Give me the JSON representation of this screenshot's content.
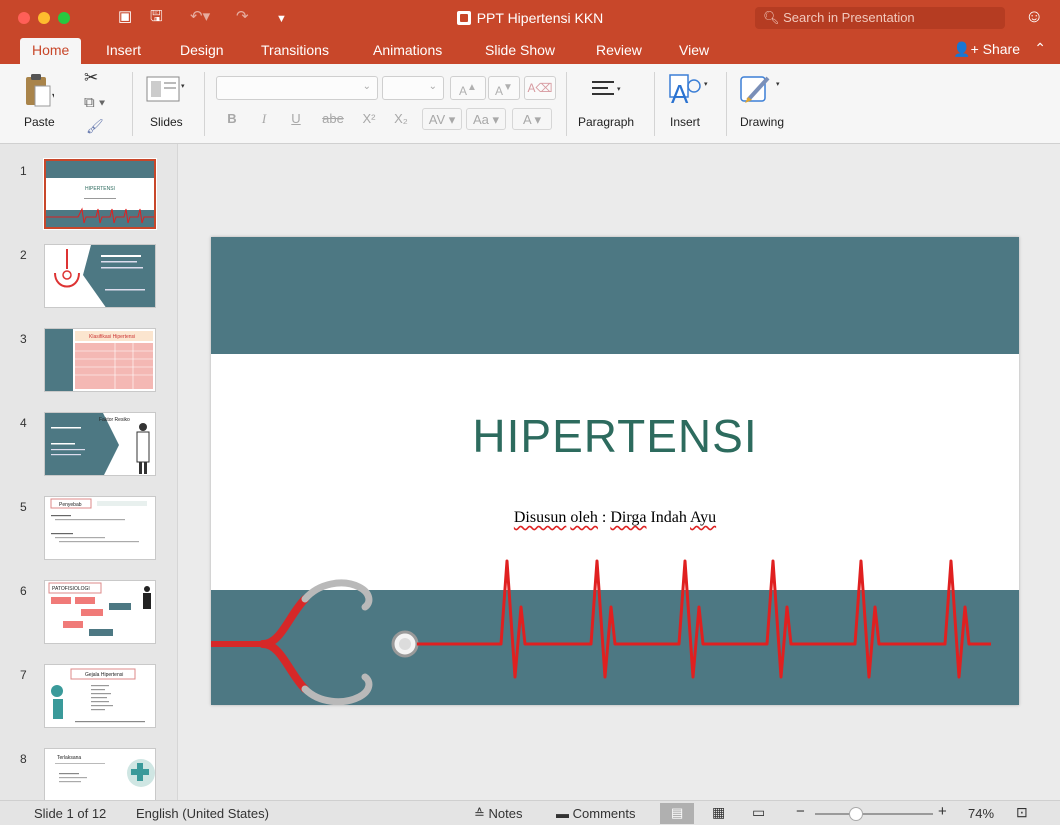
{
  "window": {
    "title": "PPT Hipertensi KKN",
    "search_placeholder": "Search in Presentation"
  },
  "colors": {
    "accent": "#c8472a",
    "slide_teal": "#4d7883",
    "title_green": "#2d6b5e",
    "ecg_red": "#e02020"
  },
  "tabs": [
    "Home",
    "Insert",
    "Design",
    "Transitions",
    "Animations",
    "Slide Show",
    "Review",
    "View"
  ],
  "active_tab": "Home",
  "share_label": "Share",
  "ribbon": {
    "paste": "Paste",
    "slides": "Slides",
    "paragraph": "Paragraph",
    "insert": "Insert",
    "drawing": "Drawing",
    "grow_font": "A",
    "shrink_font": "A",
    "bold": "B",
    "italic": "I",
    "underline": "U",
    "strike": "abe",
    "superscript": "X²",
    "subscript": "X₂",
    "char_spacing": "AV",
    "change_case": "Aa",
    "font_color": "A"
  },
  "thumbnails": [
    {
      "num": "1",
      "label": "HIPERTENSI"
    },
    {
      "num": "2",
      "label": ""
    },
    {
      "num": "3",
      "label": "Klasifikasi Hipertensi"
    },
    {
      "num": "4",
      "label": "Faktor Resiko"
    },
    {
      "num": "5",
      "label": "Penyebab"
    },
    {
      "num": "6",
      "label": "PATOFISIOLOGI"
    },
    {
      "num": "7",
      "label": "Gejala Hipertensi"
    },
    {
      "num": "8",
      "label": "Terlaksana"
    }
  ],
  "slide": {
    "title": "HIPERTENSI",
    "subtitle_words": [
      "Disusun",
      "oleh",
      ":",
      "Dirga",
      "Indah",
      "Ayu"
    ]
  },
  "status": {
    "slide_counter": "Slide 1 of 12",
    "language": "English (United States)",
    "notes": "Notes",
    "comments": "Comments",
    "zoom": "74%",
    "zoom_minus": "−",
    "zoom_plus": "+"
  }
}
